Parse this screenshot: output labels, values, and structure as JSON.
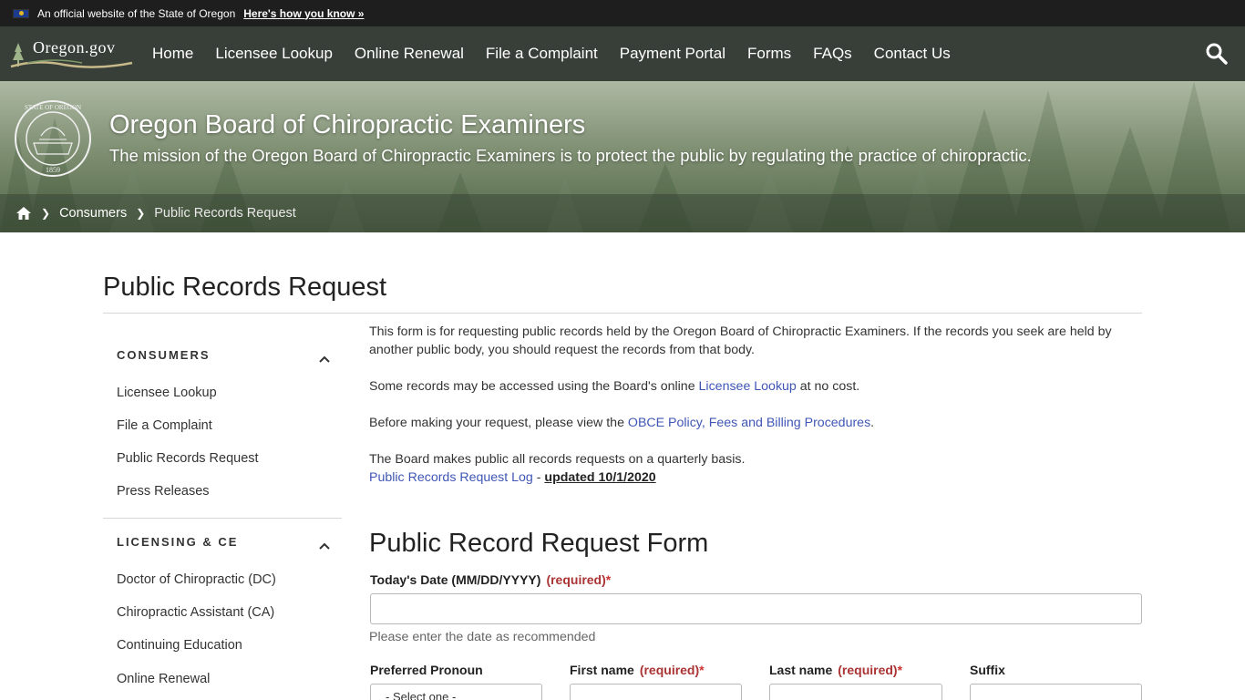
{
  "official_bar": {
    "text": "An official website of the State of Oregon",
    "link": "Here's how you know »"
  },
  "nav": {
    "logo": "Oregon.gov",
    "items": [
      {
        "label": "Home"
      },
      {
        "label": "Licensee Lookup"
      },
      {
        "label": "Online Renewal"
      },
      {
        "label": "File a Complaint"
      },
      {
        "label": "Payment Portal"
      },
      {
        "label": "Forms"
      },
      {
        "label": "FAQs"
      },
      {
        "label": "Contact Us"
      }
    ],
    "search_icon": "search-icon"
  },
  "hero": {
    "seal_text": "STATE OF OREGON",
    "seal_year": "1859",
    "title": "Oregon Board of Chiropractic Examiners",
    "mission": "The mission of the Oregon Board of Chiropractic Examiners is to protect the public by regulating the practice of chiropractic."
  },
  "breadcrumb": {
    "items": [
      {
        "label": "Consumers"
      },
      {
        "label": "Public Records Request"
      }
    ]
  },
  "page": {
    "title": "Public Records Request"
  },
  "sidebar": {
    "sections": [
      {
        "heading": "CONSUMERS",
        "links": [
          "Licensee Lookup",
          "File a Complaint",
          "Public Records Request",
          "Press Releases"
        ]
      },
      {
        "heading": "LICENSING & CE",
        "links": [
          "Doctor of Chiropractic (DC)",
          "Chiropractic Assistant (CA)",
          "Continuing Education",
          "Online Renewal"
        ]
      }
    ]
  },
  "content": {
    "p1": "This form is for requesting public records held by the Oregon Board of Chiropractic Examiners. If the records you seek are held by another public body, you should request the records from that body.",
    "p2_before": "Some records may be accessed using the Board's online ",
    "p2_link": "Licensee Lookup",
    "p2_after": " at no cost.",
    "p3_before": "Before making your request, please view the ",
    "p3_link": "OBCE Policy, Fees and Billing Procedures",
    "p3_after": ".",
    "p4": "The Board makes public all records requests on a quarterly basis.",
    "log_link": "Public Records Request Log",
    "log_sep": " - ",
    "log_updated": "updated 10/1/2020"
  },
  "form": {
    "title": "Public Record Request Form",
    "required_text": "(required)",
    "required_star": "*",
    "date_label": "Today's Date (MM/DD/YYYY)",
    "date_value": "",
    "date_help": "Please enter the date as recommended",
    "pronoun_label": "Preferred Pronoun",
    "pronoun_value": "- Select one -",
    "first_name_label": "First name",
    "first_name_value": "",
    "last_name_label": "Last name",
    "last_name_value": "",
    "suffix_label": "Suffix",
    "suffix_value": ""
  }
}
